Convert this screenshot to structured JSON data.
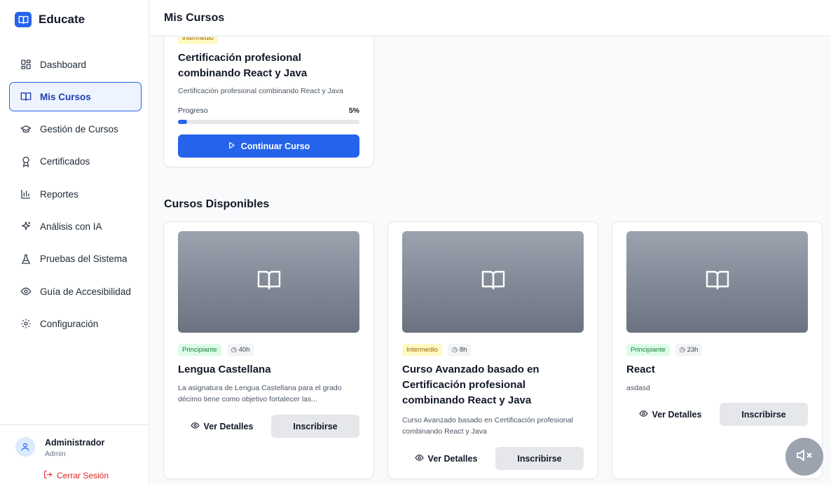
{
  "app": {
    "name": "Educate"
  },
  "sidebar": {
    "items": [
      {
        "label": "Dashboard",
        "icon": "grid-icon"
      },
      {
        "label": "Mis Cursos",
        "icon": "book-icon"
      },
      {
        "label": "Gestión de Cursos",
        "icon": "graduation-cap-icon"
      },
      {
        "label": "Certificados",
        "icon": "award-icon"
      },
      {
        "label": "Reportes",
        "icon": "bar-chart-icon"
      },
      {
        "label": "Análisis con IA",
        "icon": "sparkles-icon"
      },
      {
        "label": "Pruebas del Sistema",
        "icon": "flask-icon"
      },
      {
        "label": "Guía de Accesibilidad",
        "icon": "eye-icon"
      },
      {
        "label": "Configuración",
        "icon": "gear-icon"
      }
    ],
    "active": "Mis Cursos",
    "user": {
      "name": "Administrador",
      "role": "Admin"
    },
    "logout_label": "Cerrar Sesión"
  },
  "header": {
    "title": "Mis Cursos"
  },
  "enrolled": {
    "level": "Intermedio",
    "title": "Certificación profesional combinando React y Java",
    "description": "Certificación profesional combinando React y Java",
    "progress_label": "Progreso",
    "progress_text": "5%",
    "progress_value": 0.05,
    "continue_label": "Continuar Curso"
  },
  "available": {
    "title": "Cursos Disponibles",
    "details_label": "Ver Detalles",
    "enroll_label": "Inscribirse",
    "courses": [
      {
        "level": "Principiante",
        "duration": "40h",
        "title": "Lengua Castellana",
        "description": "La asignatura de Lengua Castellana para el grado décimo tiene como objetivo fortalecer las..."
      },
      {
        "level": "Intermedio",
        "duration": "8h",
        "title": "Curso Avanzado basado en Certificación profesional combinando React y Java",
        "description": "Curso Avanzado basado en Certificación profesional combinando React y Java"
      },
      {
        "level": "Principiante",
        "duration": "23h",
        "title": "React",
        "description": "asdasd"
      }
    ]
  },
  "colors": {
    "accent": "#2563eb",
    "intermedio": "#fef9c3",
    "principiante": "#dcfce7",
    "logout": "#dc2626"
  }
}
